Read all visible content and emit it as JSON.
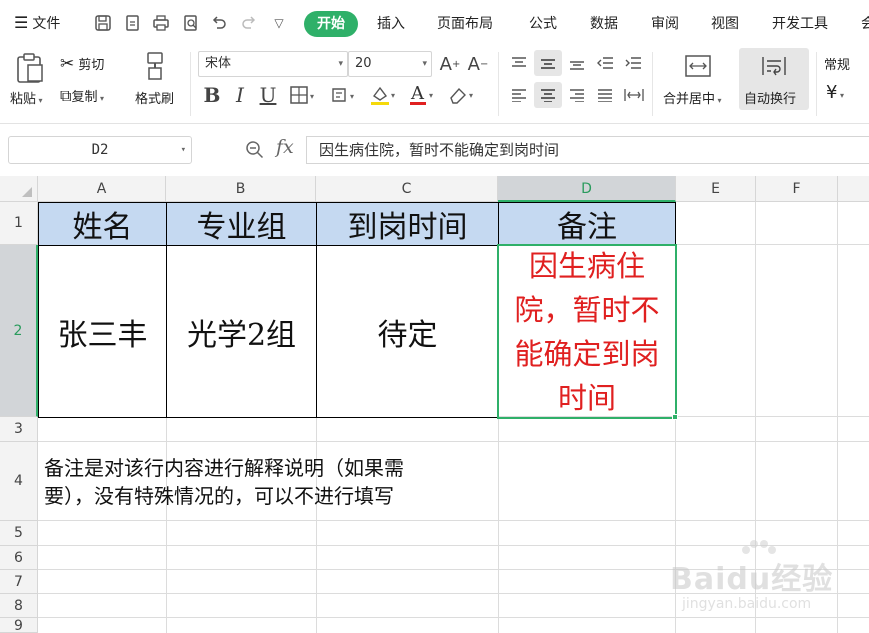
{
  "menu": {
    "file_label": "文件",
    "tabs": [
      "开始",
      "插入",
      "页面布局",
      "公式",
      "数据",
      "审阅",
      "视图",
      "开发工具",
      "会"
    ]
  },
  "ribbon": {
    "paste_label": "粘贴",
    "cut_label": "剪切",
    "copy_label": "复制",
    "format_painter_label": "格式刷",
    "font_name": "宋体",
    "font_size": "20",
    "merge_center_label": "合并居中",
    "wrap_text_label": "自动换行",
    "number_format": "常规"
  },
  "formula_bar": {
    "name_box": "D2",
    "fx_label": "fx",
    "formula": "因生病住院，暂时不能确定到岗时间"
  },
  "columns": [
    "A",
    "B",
    "C",
    "D",
    "E",
    "F"
  ],
  "rows": [
    "1",
    "2",
    "3",
    "4",
    "5",
    "6",
    "7",
    "8",
    "9"
  ],
  "sheet": {
    "headers": [
      "姓名",
      "专业组",
      "到岗时间",
      "备注"
    ],
    "row2": [
      "张三丰",
      "光学2组",
      "待定",
      "因生病住院，暂时不能确定到岗时间"
    ],
    "row4_note_line1": "备注是对该行内容进行解释说明（如果需",
    "row4_note_line2": "要），没有特殊情况的，可以不进行填写"
  },
  "watermark": {
    "main": "Baidu经验",
    "sub": "jingyan.baidu.com"
  },
  "colors": {
    "accent_green": "#2fb069",
    "header_fill": "#c5d9f1",
    "note_red": "#e02020"
  }
}
